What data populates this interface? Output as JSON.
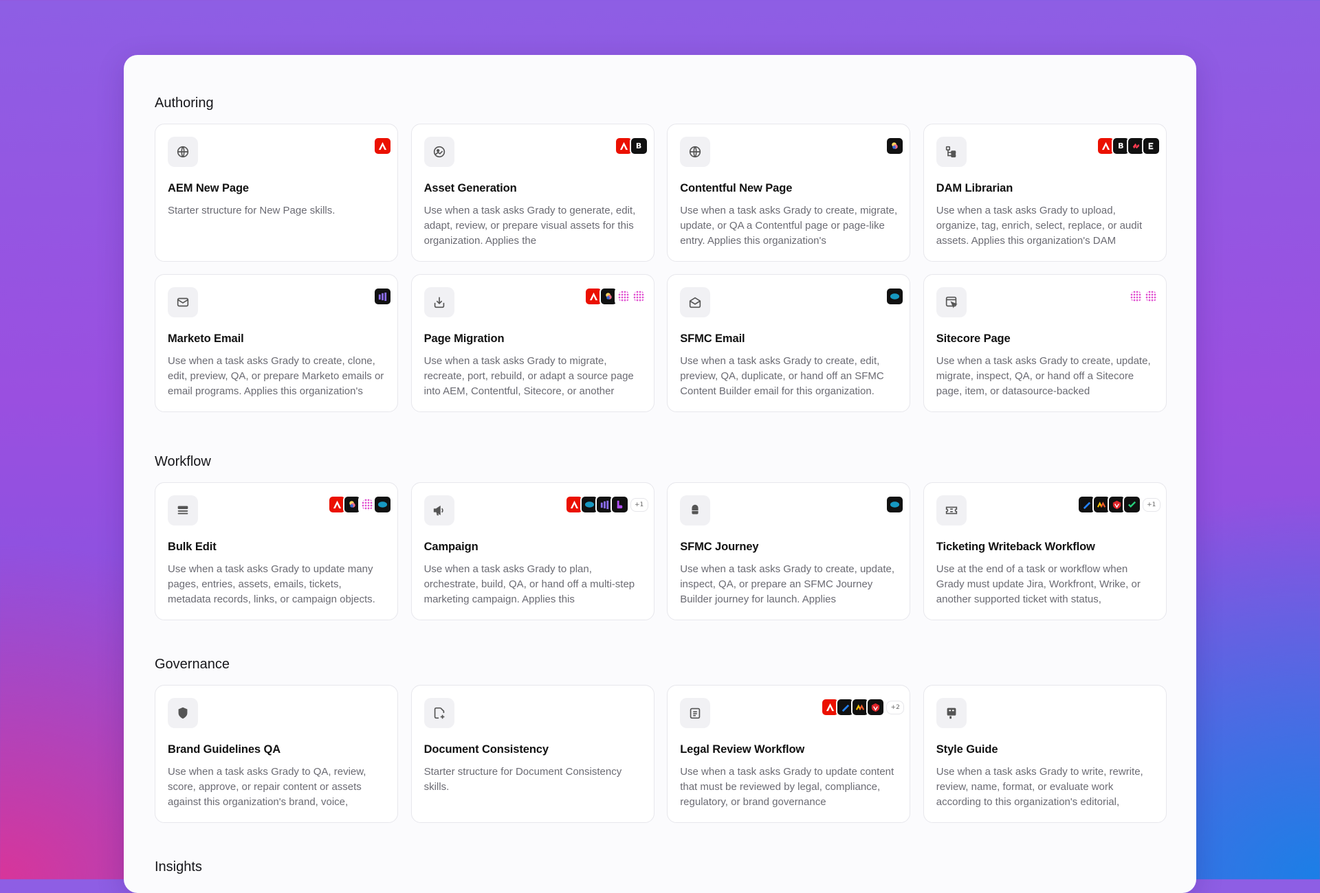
{
  "sections": [
    {
      "title": "Authoring",
      "cards": [
        {
          "title": "AEM New Page",
          "desc": "Starter structure for New Page skills.",
          "logos": [
            "adobe"
          ],
          "more": ""
        },
        {
          "title": "Asset Generation",
          "desc": "Use when a task asks Grady to generate, edit, adapt, review, or prepare visual assets for this organization. Applies the",
          "logos": [
            "adobe",
            "bynder"
          ],
          "more": ""
        },
        {
          "title": "Contentful New Page",
          "desc": "Use when a task asks Grady to create, migrate, update, or QA a Contentful page or page-like entry. Applies this organization's",
          "logos": [
            "contentful"
          ],
          "more": ""
        },
        {
          "title": "DAM Librarian",
          "desc": "Use when a task asks Grady to upload, organize, tag, enrich, select, replace, or audit assets. Applies this organization's DAM",
          "logos": [
            "adobe",
            "bynder",
            "frontify",
            "canto"
          ],
          "more": ""
        },
        {
          "title": "Marketo Email",
          "desc": "Use when a task asks Grady to create, clone, edit, preview, QA, or prepare Marketo emails or email programs. Applies this organization's",
          "logos": [
            "marketo"
          ],
          "more": ""
        },
        {
          "title": "Page Migration",
          "desc": "Use when a task asks Grady to migrate, recreate, port, rebuild, or adapt a source page into AEM, Contentful, Sitecore, or another",
          "logos": [
            "adobe",
            "contentful",
            "sitecore",
            "sitecore"
          ],
          "more": ""
        },
        {
          "title": "SFMC Email",
          "desc": "Use when a task asks Grady to create, edit, preview, QA, duplicate, or hand off an SFMC Content Builder email for this organization.",
          "logos": [
            "salesforce"
          ],
          "more": ""
        },
        {
          "title": "Sitecore Page",
          "desc": "Use when a task asks Grady to create, update, migrate, inspect, QA, or hand off a Sitecore page, item, or datasource-backed",
          "logos": [
            "sitecore",
            "sitecore"
          ],
          "more": ""
        }
      ]
    },
    {
      "title": "Workflow",
      "cards": [
        {
          "title": "Bulk Edit",
          "desc": "Use when a task asks Grady to update many pages, entries, assets, emails, tickets, metadata records, links, or campaign objects.",
          "logos": [
            "adobe",
            "contentful",
            "sitecore",
            "salesforce"
          ],
          "more": ""
        },
        {
          "title": "Campaign",
          "desc": "Use when a task asks Grady to plan, orchestrate, build, QA, or hand off a multi-step marketing campaign. Applies this",
          "logos": [
            "adobe",
            "salesforce",
            "marketo",
            "hubspot"
          ],
          "more": "+1"
        },
        {
          "title": "SFMC Journey",
          "desc": "Use when a task asks Grady to create, update, inspect, QA, or prepare an SFMC Journey Builder journey for launch. Applies",
          "logos": [
            "salesforce"
          ],
          "more": ""
        },
        {
          "title": "Ticketing Writeback Workflow",
          "desc": "Use at the end of a task or workflow when Grady must update Jira, Workfront, Wrike, or another supported ticket with status,",
          "logos": [
            "jira",
            "workfront",
            "wrike",
            "check"
          ],
          "more": "+1"
        }
      ]
    },
    {
      "title": "Governance",
      "cards": [
        {
          "title": "Brand Guidelines QA",
          "desc": "Use when a task asks Grady to QA, review, score, approve, or repair content or assets against this organization's brand, voice,",
          "logos": [],
          "more": ""
        },
        {
          "title": "Document Consistency",
          "desc": "Starter structure for Document Consistency skills.",
          "logos": [],
          "more": ""
        },
        {
          "title": "Legal Review Workflow",
          "desc": "Use when a task asks Grady to update content that must be reviewed by legal, compliance, regulatory, or brand governance",
          "logos": [
            "adobe",
            "jira",
            "workfront",
            "wrike"
          ],
          "more": "+2"
        },
        {
          "title": "Style Guide",
          "desc": "Use when a task asks Grady to write, rewrite, review, name, format, or evaluate work according to this organization's editorial,",
          "logos": [],
          "more": ""
        }
      ]
    },
    {
      "title": "Insights",
      "cards": []
    }
  ],
  "card_icons": [
    "globe-icon",
    "image-icon",
    "globe-icon",
    "folder-tree-icon",
    "mail-icon",
    "download-icon",
    "mail-open-icon",
    "window-pointer-icon",
    "layers-icon",
    "megaphone-icon",
    "cloud-icon",
    "ticket-icon",
    "shield-icon",
    "document-plus-icon",
    "clipboard-icon",
    "style-icon"
  ],
  "colors": {
    "adobe": "#eb1000",
    "contentful": "#111111",
    "salesforce": "#111111",
    "marketo": "#111111",
    "sitecore": "#e04fd0",
    "bynder": "#111111",
    "jira": "#111111",
    "workfront": "#111111",
    "wrike": "#111111"
  }
}
